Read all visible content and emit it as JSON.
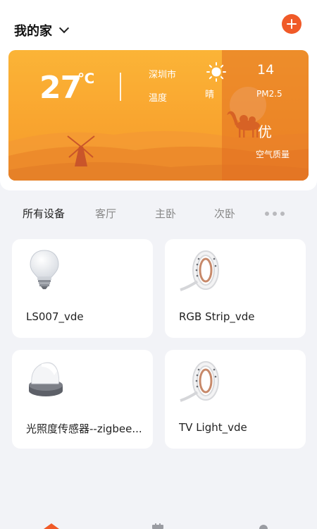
{
  "header": {
    "home_name": "我的家",
    "add_icon": "plus-icon"
  },
  "weather": {
    "temperature": "27",
    "unit": "℃",
    "city": "深圳市",
    "temp_label": "温度",
    "condition": "晴",
    "condition_icon": "sun-icon",
    "aqi_value": "14",
    "aqi_label": "PM2.5",
    "aqi_level": "优",
    "aqi_desc": "空气质量"
  },
  "tabs": [
    "所有设备",
    "客厅",
    "主卧",
    "次卧"
  ],
  "devices": [
    {
      "name": "LS007_vde",
      "icon": "bulb-icon"
    },
    {
      "name": "RGB Strip_vde",
      "icon": "light-strip-icon"
    },
    {
      "name": "光照度传感器--zigbee...",
      "icon": "light-sensor-icon"
    },
    {
      "name": "TV Light_vde",
      "icon": "light-strip-icon"
    }
  ],
  "colors": {
    "accent": "#f05a28",
    "card_orange": "#f9a52f",
    "background": "#f2f3f7"
  }
}
